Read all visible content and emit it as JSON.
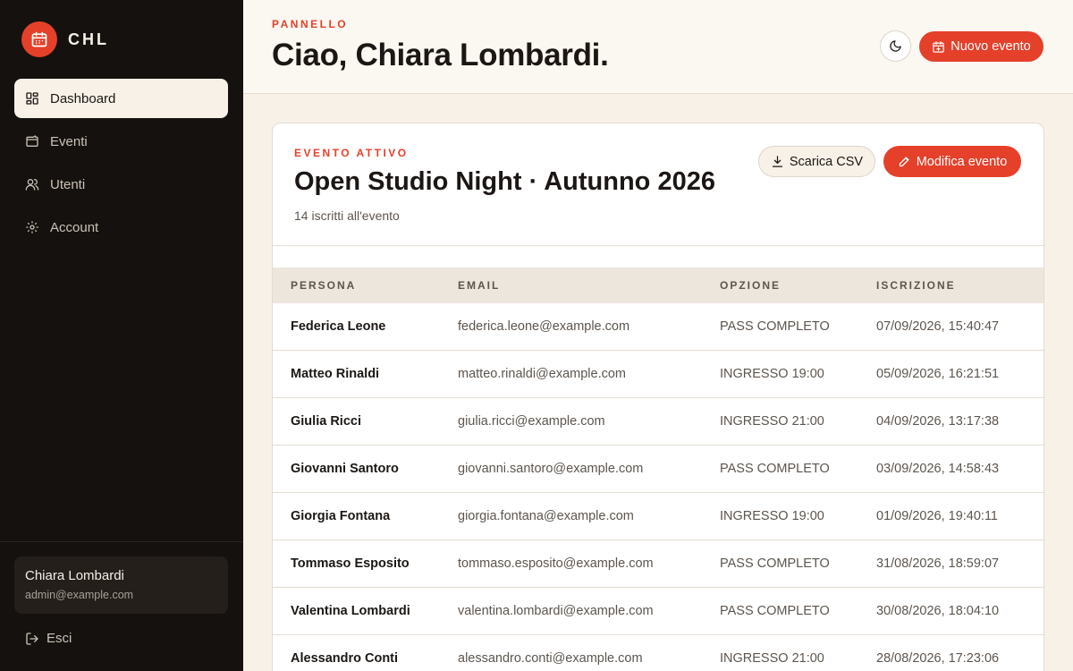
{
  "brand": {
    "name": "CHL",
    "logo_icon": "calendar-icon",
    "accent": "#e5402a"
  },
  "nav": {
    "items": [
      {
        "label": "Dashboard",
        "icon": "dashboard-icon",
        "active": true
      },
      {
        "label": "Eventi",
        "icon": "ticket-icon",
        "active": false
      },
      {
        "label": "Utenti",
        "icon": "users-icon",
        "active": false
      },
      {
        "label": "Account",
        "icon": "gear-icon",
        "active": false
      }
    ]
  },
  "user": {
    "name": "Chiara Lombardi",
    "email": "admin@example.com"
  },
  "logout_label": "Esci",
  "header": {
    "eyebrow": "PANNELLO",
    "title": "Ciao, Chiara Lombardi.",
    "new_event_label": "Nuovo evento"
  },
  "event": {
    "eyebrow": "EVENTO ATTIVO",
    "title": "Open Studio Night · Autunno 2026",
    "subtitle": "14 iscritti all'evento",
    "csv_label": "Scarica CSV",
    "edit_label": "Modifica evento"
  },
  "table": {
    "headers": [
      "PERSONA",
      "EMAIL",
      "OPZIONE",
      "ISCRIZIONE"
    ],
    "rows": [
      {
        "name": "Federica Leone",
        "email": "federica.leone@example.com",
        "option": "PASS COMPLETO",
        "date": "07/09/2026, 15:40:47"
      },
      {
        "name": "Matteo Rinaldi",
        "email": "matteo.rinaldi@example.com",
        "option": "INGRESSO 19:00",
        "date": "05/09/2026, 16:21:51"
      },
      {
        "name": "Giulia Ricci",
        "email": "giulia.ricci@example.com",
        "option": "INGRESSO 21:00",
        "date": "04/09/2026, 13:17:38"
      },
      {
        "name": "Giovanni Santoro",
        "email": "giovanni.santoro@example.com",
        "option": "PASS COMPLETO",
        "date": "03/09/2026, 14:58:43"
      },
      {
        "name": "Giorgia Fontana",
        "email": "giorgia.fontana@example.com",
        "option": "INGRESSO 19:00",
        "date": "01/09/2026, 19:40:11"
      },
      {
        "name": "Tommaso Esposito",
        "email": "tommaso.esposito@example.com",
        "option": "PASS COMPLETO",
        "date": "31/08/2026, 18:59:07"
      },
      {
        "name": "Valentina Lombardi",
        "email": "valentina.lombardi@example.com",
        "option": "PASS COMPLETO",
        "date": "30/08/2026, 18:04:10"
      },
      {
        "name": "Alessandro Conti",
        "email": "alessandro.conti@example.com",
        "option": "INGRESSO 21:00",
        "date": "28/08/2026, 17:23:06"
      }
    ]
  }
}
